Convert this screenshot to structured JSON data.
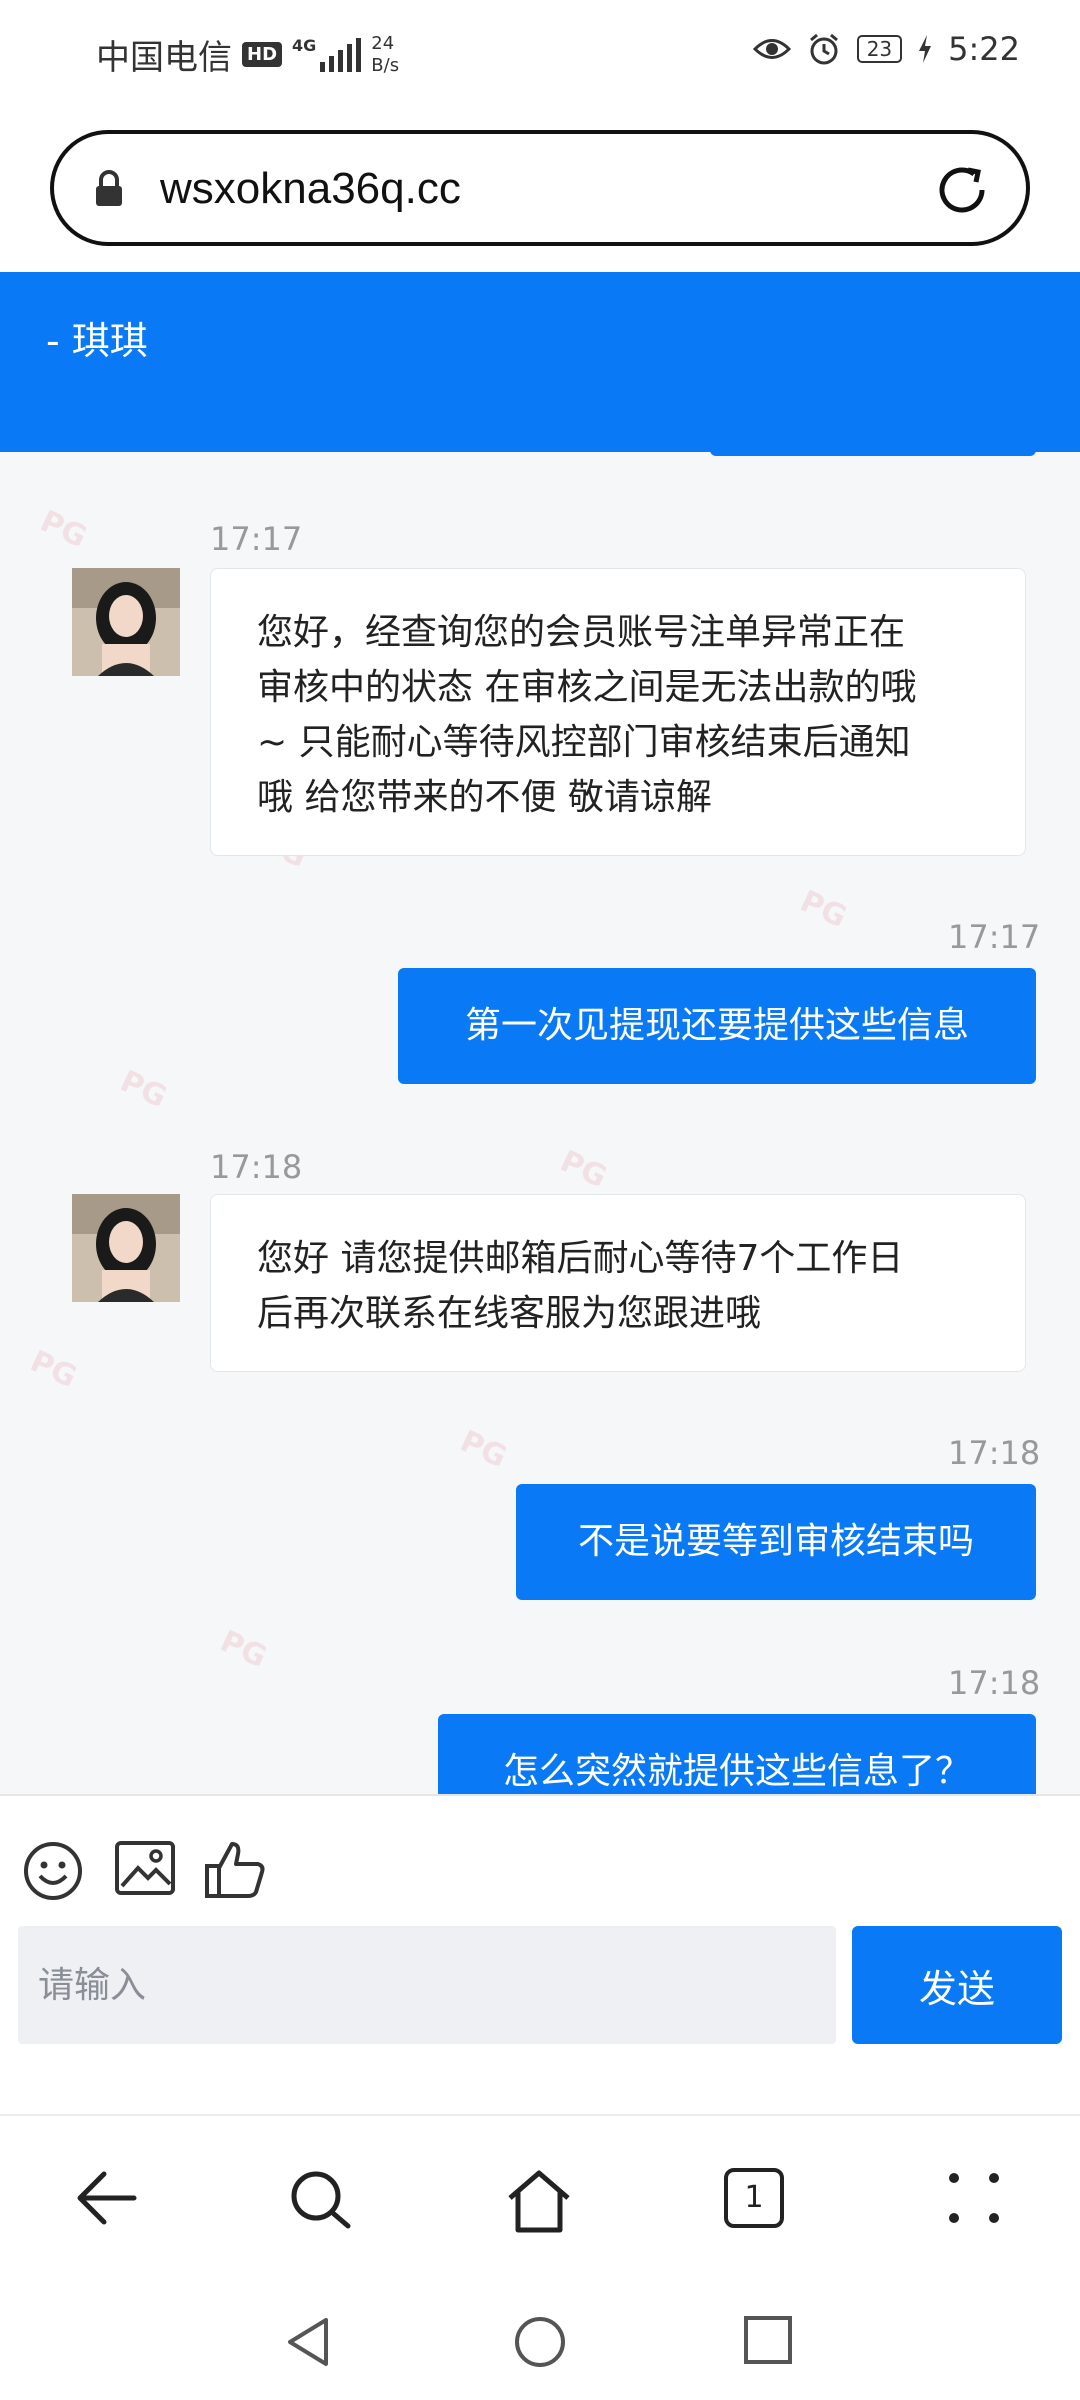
{
  "status_bar": {
    "carrier": "中国电信",
    "hd": "HD",
    "network": "4G",
    "speed_value": "24",
    "speed_unit": "B/s",
    "battery": "23",
    "time": "5:22"
  },
  "browser": {
    "url": "wsxokna36q.cc"
  },
  "chat": {
    "header_title": "- 琪琪",
    "messages": [
      {
        "from": "agent",
        "time": "17:17",
        "text": [
          "您好，经查询您的会员账号注单异常正在",
          "审核中的状态 在审核之间是无法出款的哦",
          "~ 只能耐心等待风控部门审核结束后通知",
          "哦 给您带来的不便 敬请谅解"
        ]
      },
      {
        "from": "user",
        "time": "17:17",
        "text": "第一次见提现还要提供这些信息"
      },
      {
        "from": "agent",
        "time": "17:18",
        "text": [
          "您好 请您提供邮箱后耐心等待7个工作日",
          "后再次联系在线客服为您跟进哦"
        ]
      },
      {
        "from": "user",
        "time": "17:18",
        "text": "不是说要等到审核结束吗"
      },
      {
        "from": "user",
        "time": "17:18",
        "text": "怎么突然就提供这些信息了？"
      }
    ],
    "watermark": "PG"
  },
  "composer": {
    "placeholder": "请输入",
    "send_label": "发送",
    "tools": [
      "emoji-icon",
      "image-icon",
      "thumbs-up-icon"
    ]
  },
  "nav": {
    "tab_count": "1"
  },
  "colors": {
    "accent": "#0a79f5",
    "chat_bg": "#f6f7f9"
  }
}
